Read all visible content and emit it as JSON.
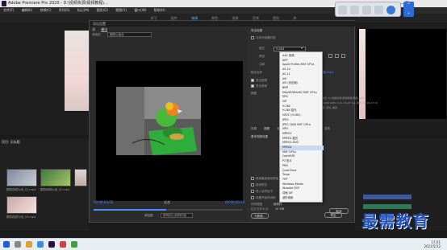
{
  "app": {
    "title": "Adobe Premiere Pro 2020 - D:\\视频资源\\视频教程\\..."
  },
  "menu": [
    "文件(F)",
    "编辑(E)",
    "剪辑(C)",
    "序列(S)",
    "标记(M)",
    "图形(G)",
    "视图(V)",
    "窗口(W)",
    "帮助(H)"
  ],
  "workspaces": [
    "学习",
    "组件",
    "编辑",
    "颜色",
    "效果",
    "音频",
    "图形",
    "库"
  ],
  "source_monitor": {
    "timecode": "00;00;00;00"
  },
  "project": {
    "header": "项目: 无标题",
    "items": [
      {
        "label": "鹦鹉视频片段_01.mp4"
      },
      {
        "label": "鹦鹉视频片段_02.mp4"
      },
      {
        "label": "鹦鹉.mp4"
      },
      {
        "label": "鹦鹉视频片段_03.mp4"
      }
    ]
  },
  "dialog": {
    "title": "导出设置",
    "tabs": [
      "源",
      "输出"
    ],
    "active_tab": "输出",
    "source_scaling_label": "源缩放",
    "source_scaling_value": "缩放以适合",
    "timecode_in": "00;00;03;05",
    "fit_label": "适合",
    "timecode_out": "00;00;20;14",
    "source_range_label": "源范围",
    "source_range_value": "序列切入/序列切出",
    "queue_button": "队列"
  },
  "export_settings": {
    "header": "导出设置",
    "match_sequence": "与序列设置匹配",
    "format_label": "格式",
    "format_value": "H.264",
    "preset_label": "预设",
    "comments_label": "注释",
    "output_name_label": "输出名称",
    "output_name_value": "鹦鹉.mp4",
    "export_video": "导出视频",
    "export_audio": "导出音频",
    "summary_label": "摘要",
    "summary_output": "输出: D:\\视频资源\\视频教程\\鹦鹉.mp4",
    "summary_details": "1920x1080 (1.0), 29.97 fps, 逐行, 00;00;17;10",
    "summary_source": "源: 序列, 鹦鹉",
    "tabs": [
      "效果",
      "视频",
      "音频",
      "多路复用器",
      "字幕",
      "发布"
    ],
    "active_tab": "视频",
    "basic_video": "基本视频设置",
    "max_render": "使用最高渲染质量",
    "use_previews": "使用预览",
    "import_project": "导入到项目中",
    "set_start_tc": "设置开始时间码",
    "time_interp_label": "时间插值",
    "time_interp_value": "帧采样",
    "file_size_label": "估计文件大小:",
    "file_size_value": "10 MB",
    "metadata_button": "元数据...",
    "ok_button": "导出",
    "cancel_button": "取消"
  },
  "format_dropdown": {
    "items": [
      "AAC 音频",
      "AIFF",
      "Apple ProRes MXF OP1a",
      "AS-10",
      "AS-11",
      "AVI",
      "AVI (未压缩)",
      "BMP",
      "DNxHR/DNxHD MXF OP1a",
      "DPX",
      "GIF",
      "H.264",
      "H.264 蓝光",
      "HEVC (H.265)",
      "JPEG",
      "JPEG 2000 MXF OP1a",
      "MP3",
      "MPEG2",
      "MPEG2 蓝光",
      "MPEG2-DVD",
      "MPEG4",
      "MXF OP1a",
      "OpenEXR",
      "P2 影片",
      "PNG",
      "QuickTime",
      "Targa",
      "TIFF",
      "Windows Media",
      "Wraptor DCP",
      "动画 GIF",
      "波形音频"
    ],
    "selected": "MPEG4"
  },
  "watermark": "最需教育",
  "clock": {
    "time": "17:01",
    "date": "2021/5/12"
  },
  "colors": {
    "accent": "#4b8cff",
    "watermark": "#1f4fc0"
  }
}
